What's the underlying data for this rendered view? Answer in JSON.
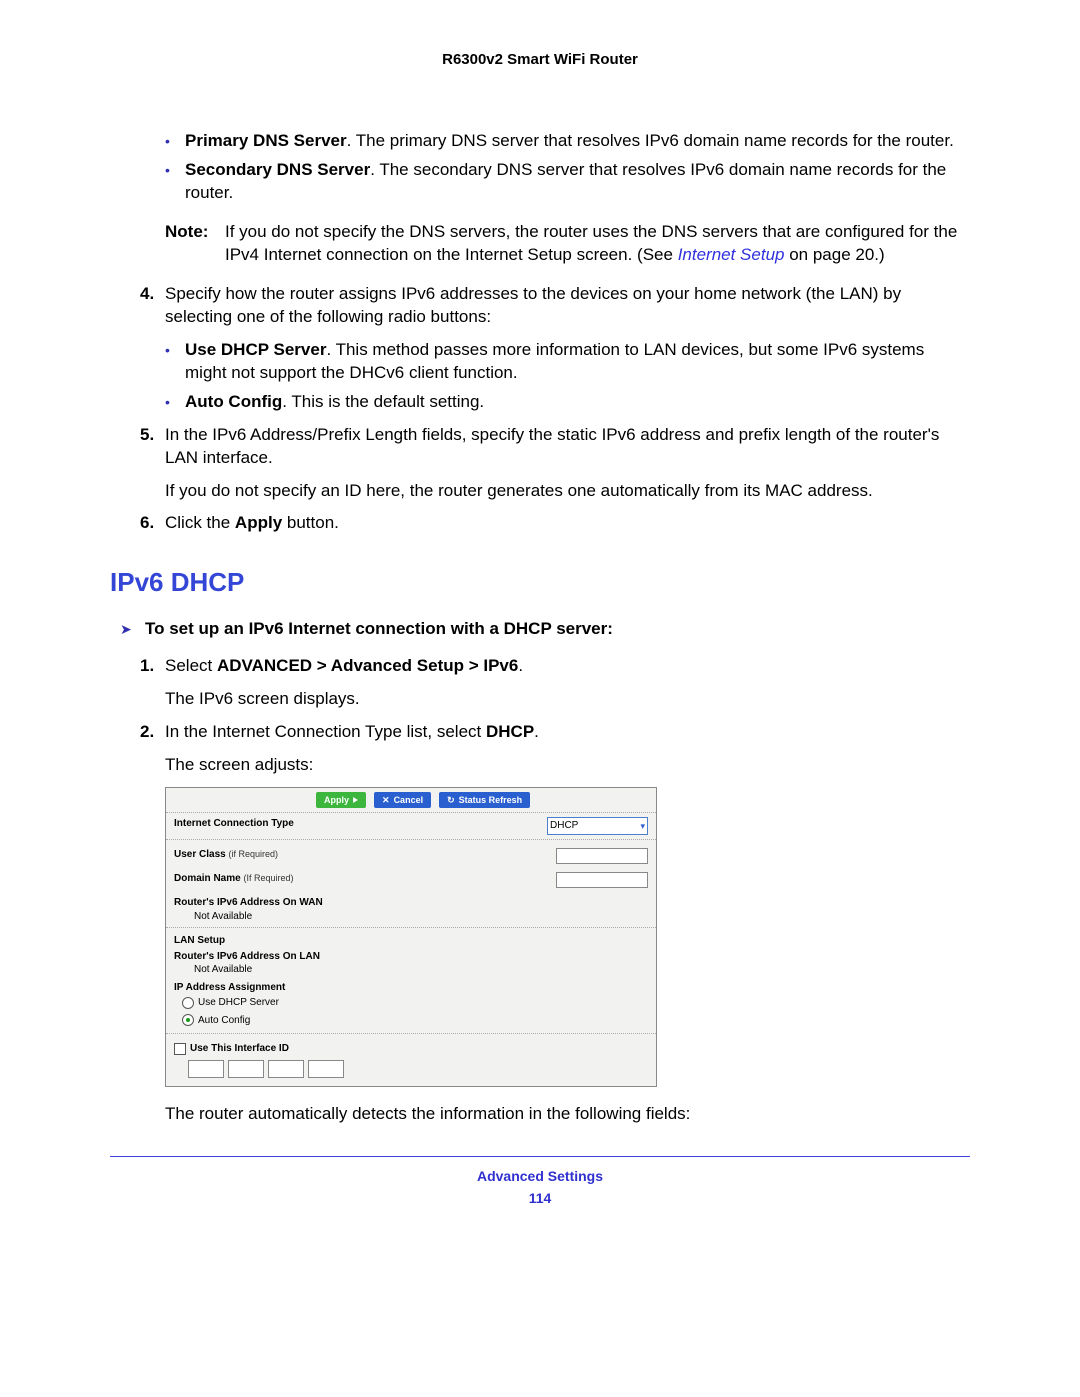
{
  "doc_title": "R6300v2 Smart WiFi Router",
  "bullets_top": [
    {
      "bold": "Primary DNS Server",
      "rest": ". The primary DNS server that resolves IPv6 domain name records for the router."
    },
    {
      "bold": "Secondary DNS Server",
      "rest": ". The secondary DNS server that resolves IPv6 domain name records for the router."
    }
  ],
  "note": {
    "label": "Note:",
    "text_a": "If you do not specify the DNS servers, the router uses the DNS servers that are configured for the IPv4 Internet connection on the Internet Setup screen. (See ",
    "link": "Internet Setup",
    "text_b": " on page 20.)"
  },
  "step4": {
    "num": "4.",
    "text": "Specify how the router assigns IPv6 addresses to the devices on your home network (the LAN) by selecting one of the following radio buttons:",
    "bullets": [
      {
        "bold": "Use DHCP Server",
        "rest": ". This method passes more information to LAN devices, but some IPv6 systems might not support the DHCv6 client function."
      },
      {
        "bold": "Auto Config",
        "rest": ". This is the default setting."
      }
    ]
  },
  "step5": {
    "num": "5.",
    "text": "In the IPv6 Address/Prefix Length fields, specify the static IPv6 address and prefix length of the router's LAN interface.",
    "after": "If you do not specify an ID here, the router generates one automatically from its MAC address."
  },
  "step6": {
    "num": "6.",
    "pre": "Click the ",
    "bold": "Apply",
    "post": " button."
  },
  "h2": "IPv6 DHCP",
  "proc": "To set up an IPv6 Internet connection with a DHCP server:",
  "d_step1": {
    "num": "1.",
    "pre": "Select ",
    "bold": "ADVANCED > Advanced Setup > IPv6",
    "post": ".",
    "after": "The IPv6 screen displays."
  },
  "d_step2": {
    "num": "2.",
    "pre": "In the Internet Connection Type list, select ",
    "bold": "DHCP",
    "post": ".",
    "after": "The screen adjusts:"
  },
  "shot": {
    "apply": "Apply",
    "cancel": "Cancel",
    "refresh": "Status Refresh",
    "conn_type_label": "Internet Connection Type",
    "conn_type_value": "DHCP",
    "user_class": "User Class",
    "if_required": "(if Required)",
    "domain_name": "Domain Name",
    "if_required2": "(If Required)",
    "wan_addr": "Router's IPv6 Address On WAN",
    "na": "Not Available",
    "lan_setup": "LAN Setup",
    "lan_addr": "Router's IPv6 Address On LAN",
    "na2": "Not Available",
    "ip_assign": "IP Address Assignment",
    "radio_dhcp": "Use DHCP Server",
    "radio_auto": "Auto Config",
    "use_iface": "Use This Interface ID"
  },
  "after_shot": "The router automatically detects the information in the following fields:",
  "footer": "Advanced Settings",
  "page_num": "114"
}
